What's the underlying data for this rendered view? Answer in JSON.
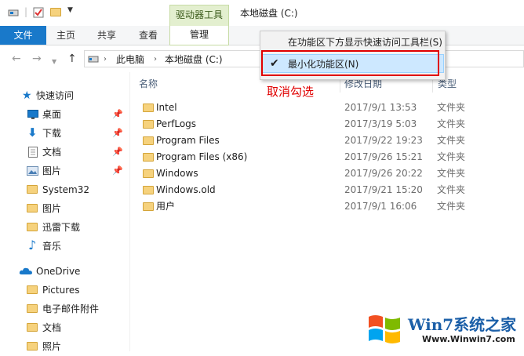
{
  "title_bar": {
    "context_tab_label": "驱动器工具",
    "window_title": "本地磁盘 (C:)"
  },
  "ribbon": {
    "file_tab": "文件",
    "tabs": [
      "主页",
      "共享",
      "查看"
    ],
    "manage_tab": "管理"
  },
  "address": {
    "crumbs": [
      "此电脑",
      "本地磁盘 (C:)"
    ]
  },
  "context_menu": {
    "items": [
      {
        "label": "在功能区下方显示快速访问工具栏(S)",
        "checked": false
      },
      {
        "label": "最小化功能区(N)",
        "checked": true
      }
    ]
  },
  "annotation": "取消勾选",
  "sidebar": {
    "quick_access": "快速访问",
    "items": [
      {
        "label": "桌面",
        "pinned": true,
        "icon": "desktop-icon"
      },
      {
        "label": "下载",
        "pinned": true,
        "icon": "download-icon"
      },
      {
        "label": "文档",
        "pinned": true,
        "icon": "document-icon"
      },
      {
        "label": "图片",
        "pinned": true,
        "icon": "pictures-icon"
      },
      {
        "label": "System32",
        "pinned": false,
        "icon": "folder-icon"
      },
      {
        "label": "图片",
        "pinned": false,
        "icon": "folder-icon"
      },
      {
        "label": "迅雷下载",
        "pinned": false,
        "icon": "folder-icon"
      },
      {
        "label": "音乐",
        "pinned": false,
        "icon": "music-icon"
      }
    ],
    "onedrive": "OneDrive",
    "onedrive_items": [
      "Pictures",
      "电子邮件附件",
      "文档",
      "照片"
    ]
  },
  "columns": {
    "name": "名称",
    "modified": "修改日期",
    "type": "类型"
  },
  "files": [
    {
      "name": "Intel",
      "modified": "2017/9/1 13:53",
      "type": "文件夹"
    },
    {
      "name": "PerfLogs",
      "modified": "2017/3/19 5:03",
      "type": "文件夹"
    },
    {
      "name": "Program Files",
      "modified": "2017/9/22 19:23",
      "type": "文件夹"
    },
    {
      "name": "Program Files (x86)",
      "modified": "2017/9/26 15:21",
      "type": "文件夹"
    },
    {
      "name": "Windows",
      "modified": "2017/9/26 20:22",
      "type": "文件夹"
    },
    {
      "name": "Windows.old",
      "modified": "2017/9/21 15:20",
      "type": "文件夹"
    },
    {
      "name": "用户",
      "modified": "2017/9/1 16:06",
      "type": "文件夹"
    }
  ],
  "watermark": {
    "brand": "Win7系统之家",
    "url": "Www.Winwin7.com"
  },
  "colors": {
    "accent": "#1979ca",
    "drive_tools": "#e3efcf",
    "highlight": "#cde8ff",
    "annotation_red": "#e00000"
  }
}
